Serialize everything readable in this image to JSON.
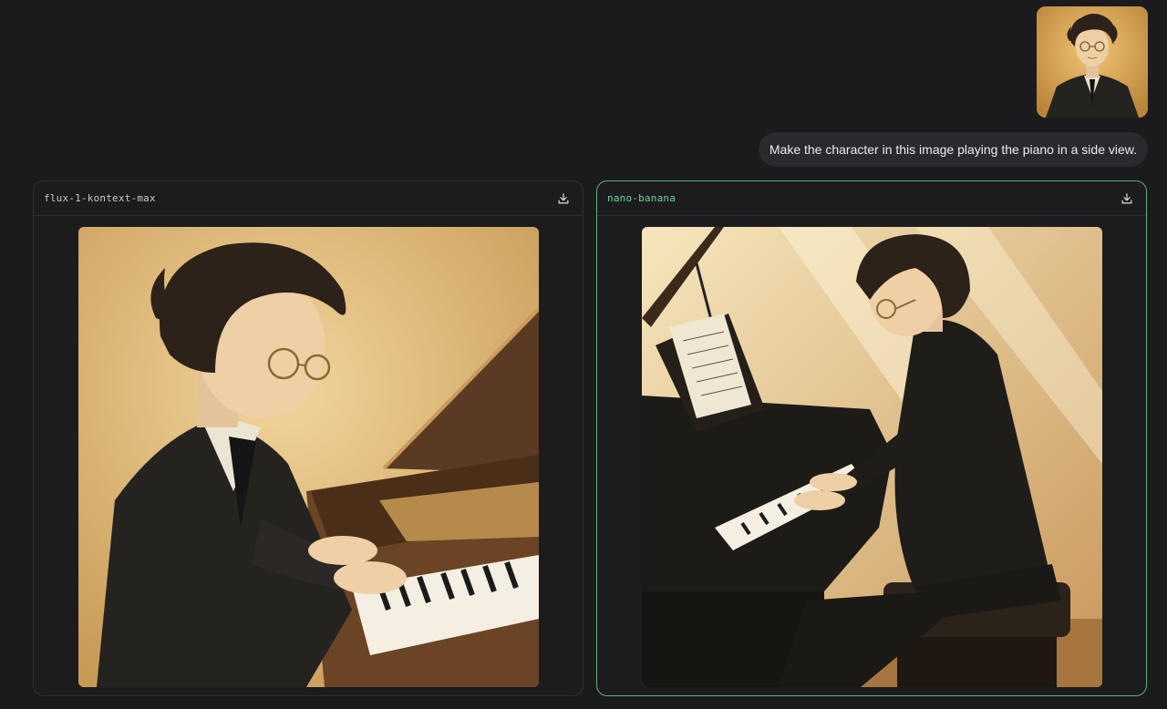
{
  "user_message": {
    "prompt": "Make the character in this image playing the piano in a side view.",
    "attachment_icon": "portrait-image"
  },
  "results": [
    {
      "model": "flux-1-kontext-max",
      "download_icon": "download-icon",
      "selected": false
    },
    {
      "model": "nano-banana",
      "download_icon": "download-icon",
      "selected": true
    }
  ],
  "colors": {
    "background": "#1b1b1e",
    "card_border": "#303034",
    "selected_border": "#5fae84",
    "selected_label": "#6fd39a",
    "bubble": "#2a2a2e"
  }
}
